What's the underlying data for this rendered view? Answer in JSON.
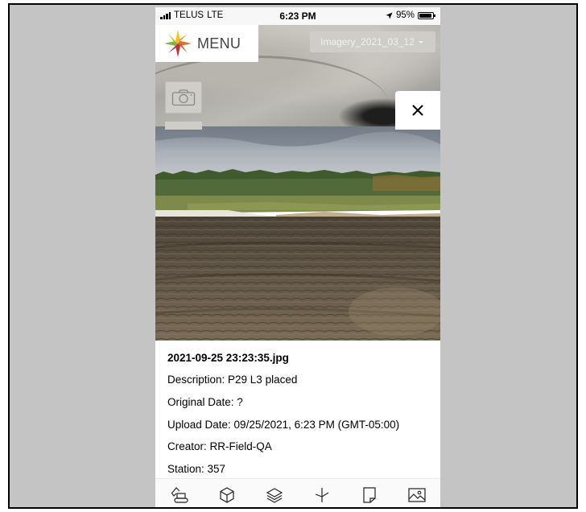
{
  "status_bar": {
    "carrier": "TELUS",
    "network": "LTE",
    "time": "6:23 PM",
    "battery": "95%"
  },
  "header": {
    "menu_label": "MENU",
    "imagery_dropdown": "Imagery_2021_03_12"
  },
  "icons": {
    "logo": "compass-star-logo-icon",
    "camera": "camera-icon",
    "close": "close-icon",
    "dropdown": "caret-down-icon"
  },
  "photo_info": {
    "filename": "2021-09-25 23:23:35.jpg",
    "description": "Description: P29 L3 placed",
    "original_date": "Original Date: ?",
    "upload_date": "Upload Date: 09/25/2021, 6:23 PM (GMT-05:00)",
    "creator": "Creator: RR-Field-QA",
    "station": "Station: 357"
  },
  "toolbar": {
    "items": [
      {
        "icon": "excavator-icon"
      },
      {
        "icon": "cube-icon"
      },
      {
        "icon": "layers-icon"
      },
      {
        "icon": "measure-icon"
      },
      {
        "icon": "document-icon"
      },
      {
        "icon": "image-icon"
      }
    ]
  },
  "colors": {
    "logo_orange": "#e8682a",
    "logo_yellow": "#f2c21b",
    "logo_red": "#c9302c",
    "logo_green": "#7cb342",
    "background": "#c4c4c4"
  }
}
